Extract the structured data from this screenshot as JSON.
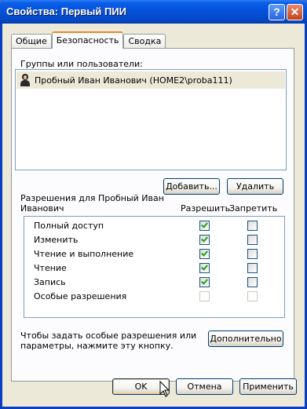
{
  "window": {
    "title": "Свойства: Первый ПИИ",
    "help_label": "?",
    "close_label": "✕"
  },
  "tabs": [
    {
      "label": "Общие",
      "active": false
    },
    {
      "label": "Безопасность",
      "active": true
    },
    {
      "label": "Сводка",
      "active": false
    }
  ],
  "groups": {
    "label": "Группы или пользователи:",
    "items": [
      {
        "label": "Пробный Иван Иванович (HOME2\\proba111)",
        "icon": "user-icon",
        "selected": true
      }
    ],
    "add_label": "Добавить...",
    "remove_label": "Удалить"
  },
  "permissions": {
    "label_line1": "Разрешения для Пробный Иван",
    "label_line2": "Иванович",
    "allow_header": "Разрешить",
    "deny_header": "Запретить",
    "rows": [
      {
        "name": "Полный доступ",
        "allow": true,
        "deny": false,
        "enabled": true
      },
      {
        "name": "Изменить",
        "allow": true,
        "deny": false,
        "enabled": true
      },
      {
        "name": "Чтение и выполнение",
        "allow": true,
        "deny": false,
        "enabled": true
      },
      {
        "name": "Чтение",
        "allow": true,
        "deny": false,
        "enabled": true
      },
      {
        "name": "Запись",
        "allow": true,
        "deny": false,
        "enabled": true
      },
      {
        "name": "Особые разрешения",
        "allow": false,
        "deny": false,
        "enabled": false
      }
    ]
  },
  "advanced": {
    "text_line1": "Чтобы задать особые разрешения или",
    "text_line2": "параметры, нажмите эту кнопку.",
    "button_label": "Дополнительно"
  },
  "footer": {
    "ok_label": "OK",
    "cancel_label": "Отмена",
    "apply_label": "Применить"
  }
}
